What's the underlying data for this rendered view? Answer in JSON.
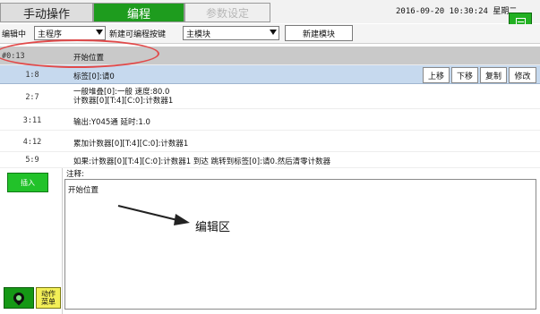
{
  "header": {
    "tabs": {
      "manual": "手动操作",
      "program": "编程",
      "params": "参数设定"
    },
    "datetime": "2016-09-20  10:30:24  星期二"
  },
  "toolbar": {
    "edit_label": "编辑中",
    "program_select": "主程序",
    "new_button_label": "新建可编程按键",
    "module_select": "主模块",
    "new_module_button": "新建模块"
  },
  "program": {
    "header_row": {
      "num": "#0:13",
      "text": "开始位置"
    },
    "rows": [
      {
        "num": "1:8",
        "text": "标签[0]:请0"
      },
      {
        "num": "2:7",
        "line1": "一般堆叠[0]:一般 速度:80.0",
        "line2": "计数器[0][T:4][C:0]:计数器1"
      },
      {
        "num": "3:11",
        "text": "输出:Y045通 延时:1.0"
      },
      {
        "num": "4:12",
        "text": "累加计数器[0][T:4][C:0]:计数器1"
      },
      {
        "num": "5:9",
        "text": "如果:计数器[0][T:4][C:0]:计数器1 到达 跳转到标签[0]:请0.然后清零计数器"
      }
    ],
    "row_actions": [
      "上移",
      "下移",
      "复制",
      "修改"
    ]
  },
  "editor": {
    "comment_label": "注释:",
    "content": "开始位置",
    "annotation": "编辑区"
  },
  "side": {
    "insert_button": "插入",
    "action_menu_line1": "动作",
    "action_menu_line2": "菜单"
  },
  "colors": {
    "active_tab": "#1e9c1e",
    "selected_row": "#c6d9ee",
    "insert_button": "#22c22a",
    "action_menu": "#f3ef57",
    "annotation": "#e14a4a"
  }
}
